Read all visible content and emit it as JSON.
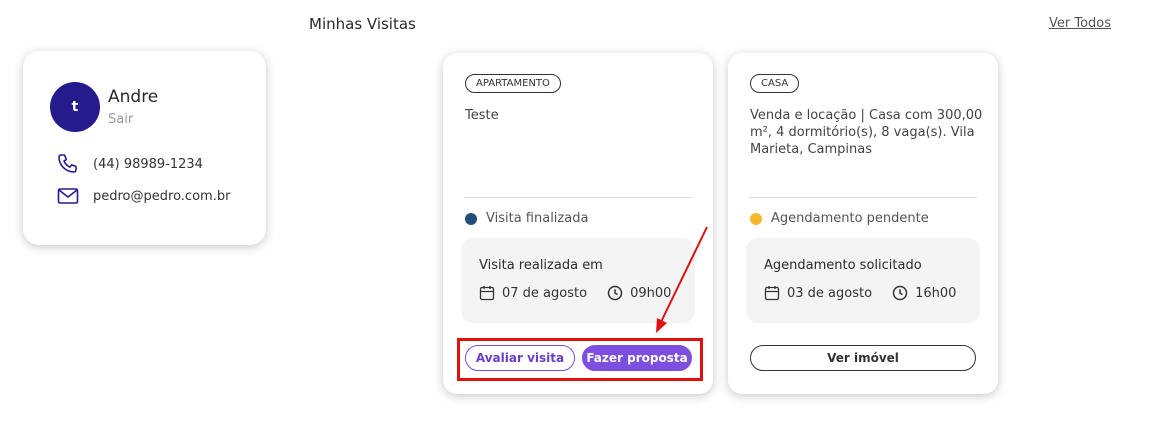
{
  "header": {
    "title": "Minhas Visitas",
    "see_all": "Ver Todos"
  },
  "profile": {
    "avatar_initial": "t",
    "name": "Andre",
    "logout": "Sair",
    "phone": "(44) 98989-1234",
    "email": "pedro@pedro.com.br",
    "avatar_color": "#241c8c"
  },
  "visits": [
    {
      "type": "APARTAMENTO",
      "description": "Teste",
      "status": "Visita finalizada",
      "status_color": "#1f4e79",
      "info_title": "Visita realizada em",
      "date": "07 de agosto",
      "time": "09h00",
      "buttons": [
        "Avaliar visita",
        "Fazer proposta"
      ]
    },
    {
      "type": "CASA",
      "description": "Venda e locação | Casa com 300,00 m², 4 dormitório(s), 8 vaga(s). Vila Marieta, Campinas",
      "status": "Agendamento pendente",
      "status_color": "#f5b82e",
      "info_title": "Agendamento solicitado",
      "date": "03 de agosto",
      "time": "16h00",
      "buttons": [
        "Ver imóvel"
      ]
    }
  ],
  "colors": {
    "accent_purple": "#7d4fe0",
    "annotation_red": "#e01010"
  }
}
